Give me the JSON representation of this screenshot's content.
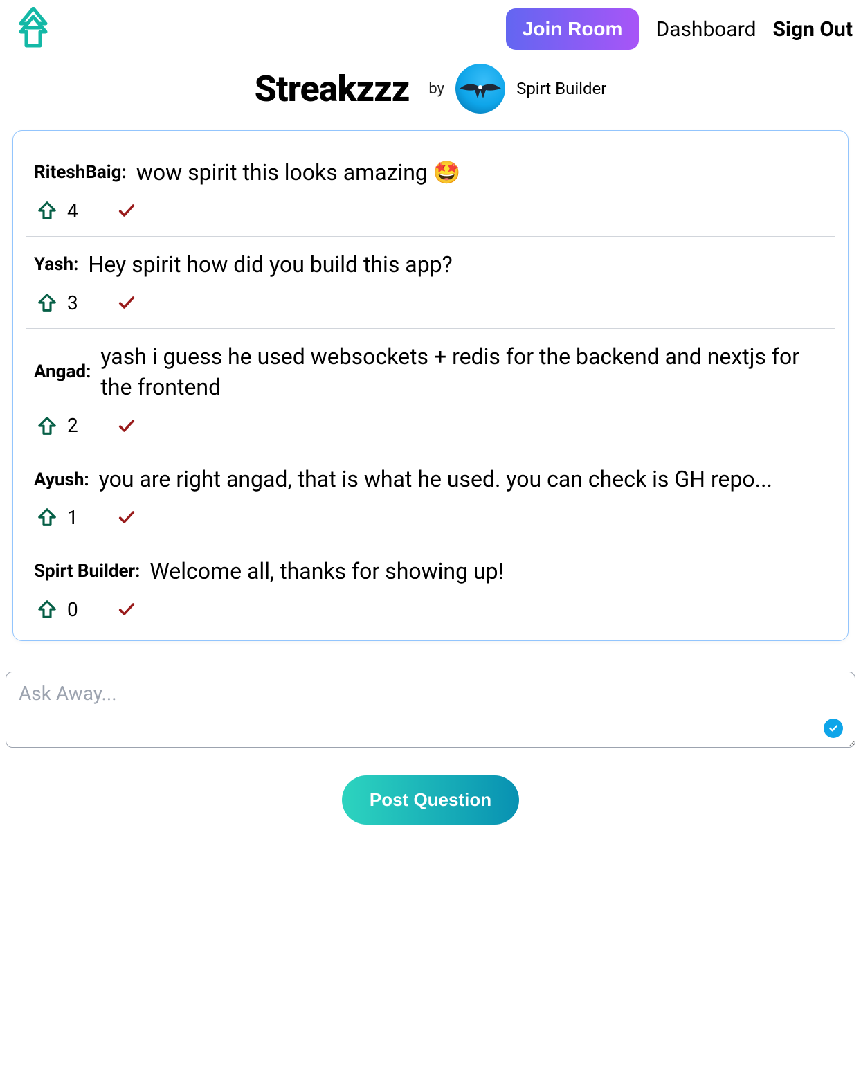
{
  "header": {
    "join_room_label": "Join Room",
    "dashboard_label": "Dashboard",
    "signout_label": "Sign Out"
  },
  "room": {
    "title": "Streakzzz",
    "by_label": "by",
    "author": "Spirt Builder"
  },
  "messages": [
    {
      "user": "RiteshBaig:",
      "text": "wow spirit this looks amazing 🤩",
      "upvotes": "4"
    },
    {
      "user": "Yash:",
      "text": "Hey spirit how did you build this app?",
      "upvotes": "3"
    },
    {
      "user": "Angad:",
      "text": "yash i guess he used websockets + redis for the backend and nextjs for the frontend",
      "upvotes": "2"
    },
    {
      "user": "Ayush:",
      "text": "you are right angad, that is what he used. you can check is GH repo...",
      "upvotes": "1"
    },
    {
      "user": "Spirt Builder:",
      "text": "Welcome all, thanks for showing up!",
      "upvotes": "0"
    }
  ],
  "input": {
    "placeholder": "Ask Away...",
    "post_label": "Post Question"
  }
}
